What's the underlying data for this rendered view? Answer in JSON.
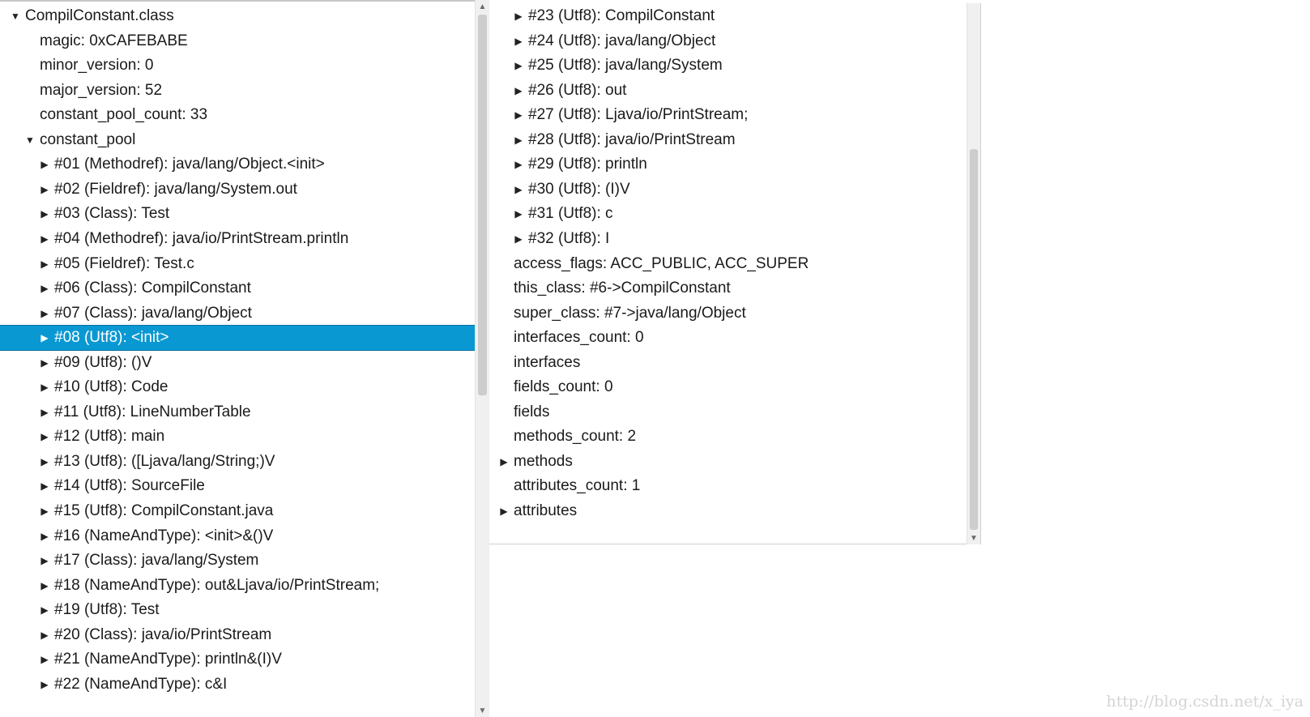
{
  "left_tree": {
    "rows": [
      {
        "label": "CompilConstant.class",
        "arrow": "▼"
      },
      {
        "label": "magic: 0xCAFEBABE",
        "arrow": ""
      },
      {
        "label": "minor_version: 0",
        "arrow": ""
      },
      {
        "label": "major_version: 52",
        "arrow": ""
      },
      {
        "label": "constant_pool_count: 33",
        "arrow": ""
      },
      {
        "label": "constant_pool",
        "arrow": "▼"
      },
      {
        "label": "#01 (Methodref): java/lang/Object.<init>",
        "arrow": "▶"
      },
      {
        "label": "#02 (Fieldref): java/lang/System.out",
        "arrow": "▶"
      },
      {
        "label": "#03 (Class): Test",
        "arrow": "▶"
      },
      {
        "label": "#04 (Methodref): java/io/PrintStream.println",
        "arrow": "▶"
      },
      {
        "label": "#05 (Fieldref): Test.c",
        "arrow": "▶"
      },
      {
        "label": "#06 (Class): CompilConstant",
        "arrow": "▶"
      },
      {
        "label": "#07 (Class): java/lang/Object",
        "arrow": "▶"
      },
      {
        "label": "#08 (Utf8): <init>",
        "arrow": "▶"
      },
      {
        "label": "#09 (Utf8): ()V",
        "arrow": "▶"
      },
      {
        "label": "#10 (Utf8): Code",
        "arrow": "▶"
      },
      {
        "label": "#11 (Utf8): LineNumberTable",
        "arrow": "▶"
      },
      {
        "label": "#12 (Utf8): main",
        "arrow": "▶"
      },
      {
        "label": "#13 (Utf8): ([Ljava/lang/String;)V",
        "arrow": "▶"
      },
      {
        "label": "#14 (Utf8): SourceFile",
        "arrow": "▶"
      },
      {
        "label": "#15 (Utf8): CompilConstant.java",
        "arrow": "▶"
      },
      {
        "label": "#16 (NameAndType): <init>&()V",
        "arrow": "▶"
      },
      {
        "label": "#17 (Class): java/lang/System",
        "arrow": "▶"
      },
      {
        "label": "#18 (NameAndType): out&Ljava/io/PrintStream;",
        "arrow": "▶"
      },
      {
        "label": "#19 (Utf8): Test",
        "arrow": "▶"
      },
      {
        "label": "#20 (Class): java/io/PrintStream",
        "arrow": "▶"
      },
      {
        "label": "#21 (NameAndType): println&(I)V",
        "arrow": "▶"
      },
      {
        "label": "#22 (NameAndType): c&I",
        "arrow": "▶"
      }
    ],
    "selected_label": "#08 (Utf8): <init>"
  },
  "right_tree": {
    "rows": [
      {
        "label": "#23 (Utf8): CompilConstant",
        "arrow": "▶"
      },
      {
        "label": "#24 (Utf8): java/lang/Object",
        "arrow": "▶"
      },
      {
        "label": "#25 (Utf8): java/lang/System",
        "arrow": "▶"
      },
      {
        "label": "#26 (Utf8): out",
        "arrow": "▶"
      },
      {
        "label": "#27 (Utf8): Ljava/io/PrintStream;",
        "arrow": "▶"
      },
      {
        "label": "#28 (Utf8): java/io/PrintStream",
        "arrow": "▶"
      },
      {
        "label": "#29 (Utf8): println",
        "arrow": "▶"
      },
      {
        "label": "#30 (Utf8): (I)V",
        "arrow": "▶"
      },
      {
        "label": "#31 (Utf8): c",
        "arrow": "▶"
      },
      {
        "label": "#32 (Utf8): I",
        "arrow": "▶"
      },
      {
        "label": "access_flags: ACC_PUBLIC, ACC_SUPER",
        "arrow": ""
      },
      {
        "label": "this_class: #6->CompilConstant",
        "arrow": ""
      },
      {
        "label": "super_class: #7->java/lang/Object",
        "arrow": ""
      },
      {
        "label": "interfaces_count: 0",
        "arrow": ""
      },
      {
        "label": "interfaces",
        "arrow": ""
      },
      {
        "label": "fields_count: 0",
        "arrow": ""
      },
      {
        "label": "fields",
        "arrow": ""
      },
      {
        "label": "methods_count: 2",
        "arrow": ""
      },
      {
        "label": "methods",
        "arrow": "▶"
      },
      {
        "label": "attributes_count: 1",
        "arrow": ""
      },
      {
        "label": "attributes",
        "arrow": "▶"
      }
    ]
  },
  "scrollbar": {
    "up_arrow": "▲",
    "down_arrow": "▼"
  },
  "watermark": "http://blog.csdn.net/x_iya",
  "colors": {
    "selection": "#0a98d2",
    "selection_text": "#ffffff"
  }
}
